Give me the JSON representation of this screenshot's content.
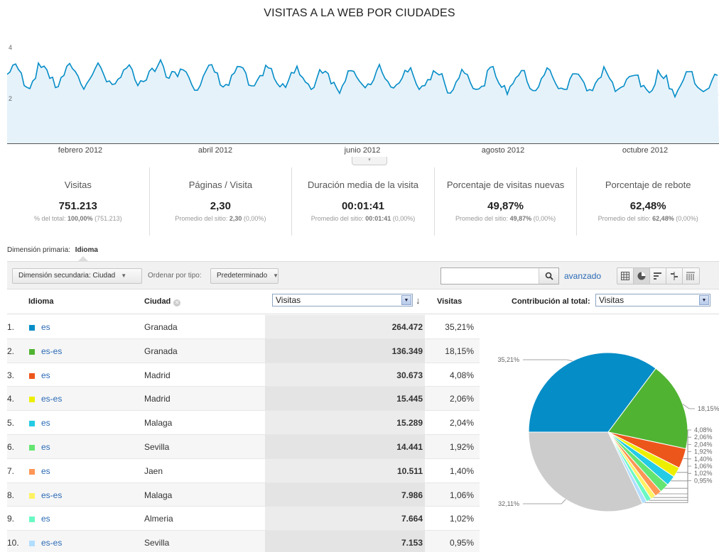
{
  "title": "VISITAS A LA WEB POR CIUDADES",
  "trend": {
    "y_top": "4",
    "y_mid": "2",
    "line_color": "#058dc7",
    "fill_color": "#e6f2fa",
    "months": [
      "febrero 2012",
      "abril 2012",
      "junio 2012",
      "agosto 2012",
      "octubre 2012"
    ]
  },
  "metrics": [
    {
      "label": "Visitas",
      "value": "751.213",
      "sub_prefix": "% del total: ",
      "sub_bold": "100,00%",
      "sub_suffix": " (751.213)"
    },
    {
      "label": "Páginas / Visita",
      "value": "2,30",
      "sub_prefix": "Promedio del sitio: ",
      "sub_bold": "2,30",
      "sub_suffix": " (0,00%)"
    },
    {
      "label": "Duración media de la visita",
      "value": "00:01:41",
      "sub_prefix": "Promedio del sitio: ",
      "sub_bold": "00:01:41",
      "sub_suffix": " (0,00%)"
    },
    {
      "label": "Porcentaje de visitas nuevas",
      "value": "49,87%",
      "sub_prefix": "Promedio del sitio: ",
      "sub_bold": "49,87%",
      "sub_suffix": " (0,00%)"
    },
    {
      "label": "Porcentaje de rebote",
      "value": "62,48%",
      "sub_prefix": "Promedio del sitio: ",
      "sub_bold": "62,48%",
      "sub_suffix": " (0,00%)"
    }
  ],
  "dimension": {
    "label": "Dimensión primaria:",
    "value": "Idioma"
  },
  "toolbar": {
    "secondary_label": "Dimensión secundaria: Ciudad",
    "sort_label": "Ordenar por tipo:",
    "order_label": "Predeterminado",
    "search_value": "",
    "advanced_label": "avanzado"
  },
  "table": {
    "col_idioma": "Idioma",
    "col_ciudad": "Ciudad",
    "metric_select": "Visitas",
    "col_visitas": "Visitas",
    "contrib_label": "Contribución al total:",
    "contrib_select": "Visitas",
    "rows": [
      {
        "num": "1.",
        "lang": "es",
        "city": "Granada",
        "visits": "264.472",
        "pct": "35,21%",
        "color": "#058dc7"
      },
      {
        "num": "2.",
        "lang": "es-es",
        "city": "Granada",
        "visits": "136.349",
        "pct": "18,15%",
        "color": "#50b432"
      },
      {
        "num": "3.",
        "lang": "es",
        "city": "Madrid",
        "visits": "30.673",
        "pct": "4,08%",
        "color": "#ed561b"
      },
      {
        "num": "4.",
        "lang": "es-es",
        "city": "Madrid",
        "visits": "15.445",
        "pct": "2,06%",
        "color": "#edef00"
      },
      {
        "num": "5.",
        "lang": "es",
        "city": "Malaga",
        "visits": "15.289",
        "pct": "2,04%",
        "color": "#24cbe5"
      },
      {
        "num": "6.",
        "lang": "es",
        "city": "Sevilla",
        "visits": "14.441",
        "pct": "1,92%",
        "color": "#64e572"
      },
      {
        "num": "7.",
        "lang": "es",
        "city": "Jaen",
        "visits": "10.511",
        "pct": "1,40%",
        "color": "#ff9655"
      },
      {
        "num": "8.",
        "lang": "es-es",
        "city": "Malaga",
        "visits": "7.986",
        "pct": "1,06%",
        "color": "#fff263"
      },
      {
        "num": "9.",
        "lang": "es",
        "city": "Almeria",
        "visits": "7.664",
        "pct": "1,02%",
        "color": "#6af9c4"
      },
      {
        "num": "10.",
        "lang": "es-es",
        "city": "Sevilla",
        "visits": "7.153",
        "pct": "0,95%",
        "color": "#b2deff"
      }
    ]
  },
  "chart_data": {
    "type": "pie",
    "title": "",
    "categories": [
      "1. es Granada",
      "2. es-es Granada",
      "3. es Madrid",
      "4. es-es Madrid",
      "5. es Malaga",
      "6. es Sevilla",
      "7. es Jaen",
      "8. es-es Malaga",
      "9. es Almeria",
      "10. es-es Sevilla",
      "otros"
    ],
    "values": [
      35.21,
      18.15,
      4.08,
      2.06,
      2.04,
      1.92,
      1.4,
      1.06,
      1.02,
      0.95,
      32.11
    ],
    "labels": [
      "35,21%",
      "18,15%",
      "4,08%",
      "2,06%",
      "2,04%",
      "1,92%",
      "1,40%",
      "1,06%",
      "1,02%",
      "0,95%",
      "32,11%"
    ],
    "colors": [
      "#058dc7",
      "#50b432",
      "#ed561b",
      "#edef00",
      "#24cbe5",
      "#64e572",
      "#ff9655",
      "#fff263",
      "#6af9c4",
      "#b2deff",
      "#cccccc"
    ]
  }
}
